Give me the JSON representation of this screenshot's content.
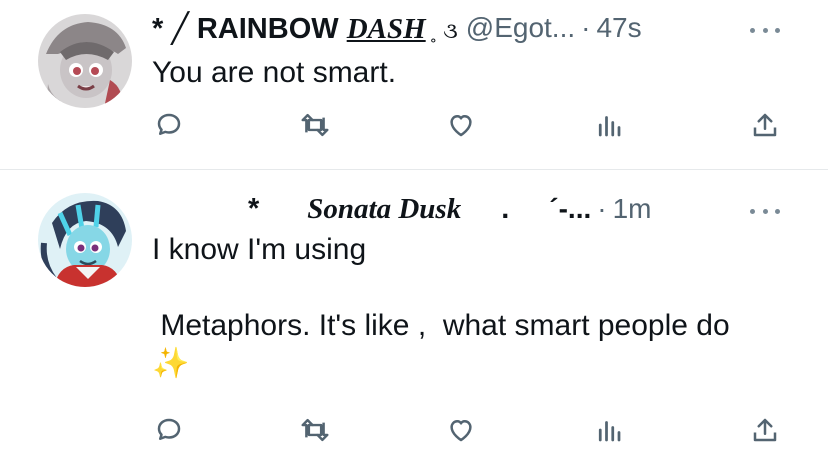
{
  "tweets": [
    {
      "name": "* ╱ RAINBOW DASH ˳ ૩",
      "name_parts": [
        "*  ╱  RAINBOW ",
        "DASH",
        "˳ ૩"
      ],
      "handle": "@Egot...",
      "time": "47s",
      "text": "You are not smart.",
      "more_icon": "more-horizontal-icon"
    },
    {
      "name_parts": [
        "*",
        "Sonata Dusk",
        ".",
        "´-..."
      ],
      "time": "1m",
      "text_lines": [
        "I know I'm using",
        "",
        " Metaphors. It's like ,  what smart people do"
      ],
      "emoji": "✨",
      "more_icon": "more-horizontal-icon"
    }
  ],
  "action_icons": [
    "reply-icon",
    "retweet-icon",
    "like-icon",
    "views-icon",
    "share-icon"
  ],
  "colors": {
    "text": "#0f1419",
    "secondary": "#536471",
    "icon": "#536471",
    "divider": "#e6e9eb"
  }
}
